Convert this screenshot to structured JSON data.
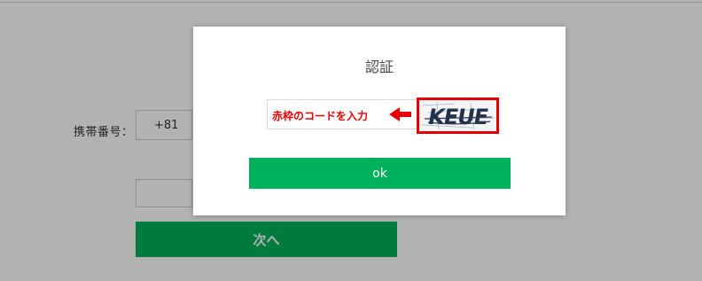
{
  "form": {
    "phone_label": "携帯番号：",
    "country_code": "+81",
    "next_label": "次へ"
  },
  "dialog": {
    "title": "認証",
    "captcha_hint": "赤枠のコードを入力",
    "captcha_text": "KEUE",
    "ok_label": "ok"
  },
  "colors": {
    "accent_green": "#00b15c",
    "highlight_red": "#e60000"
  }
}
